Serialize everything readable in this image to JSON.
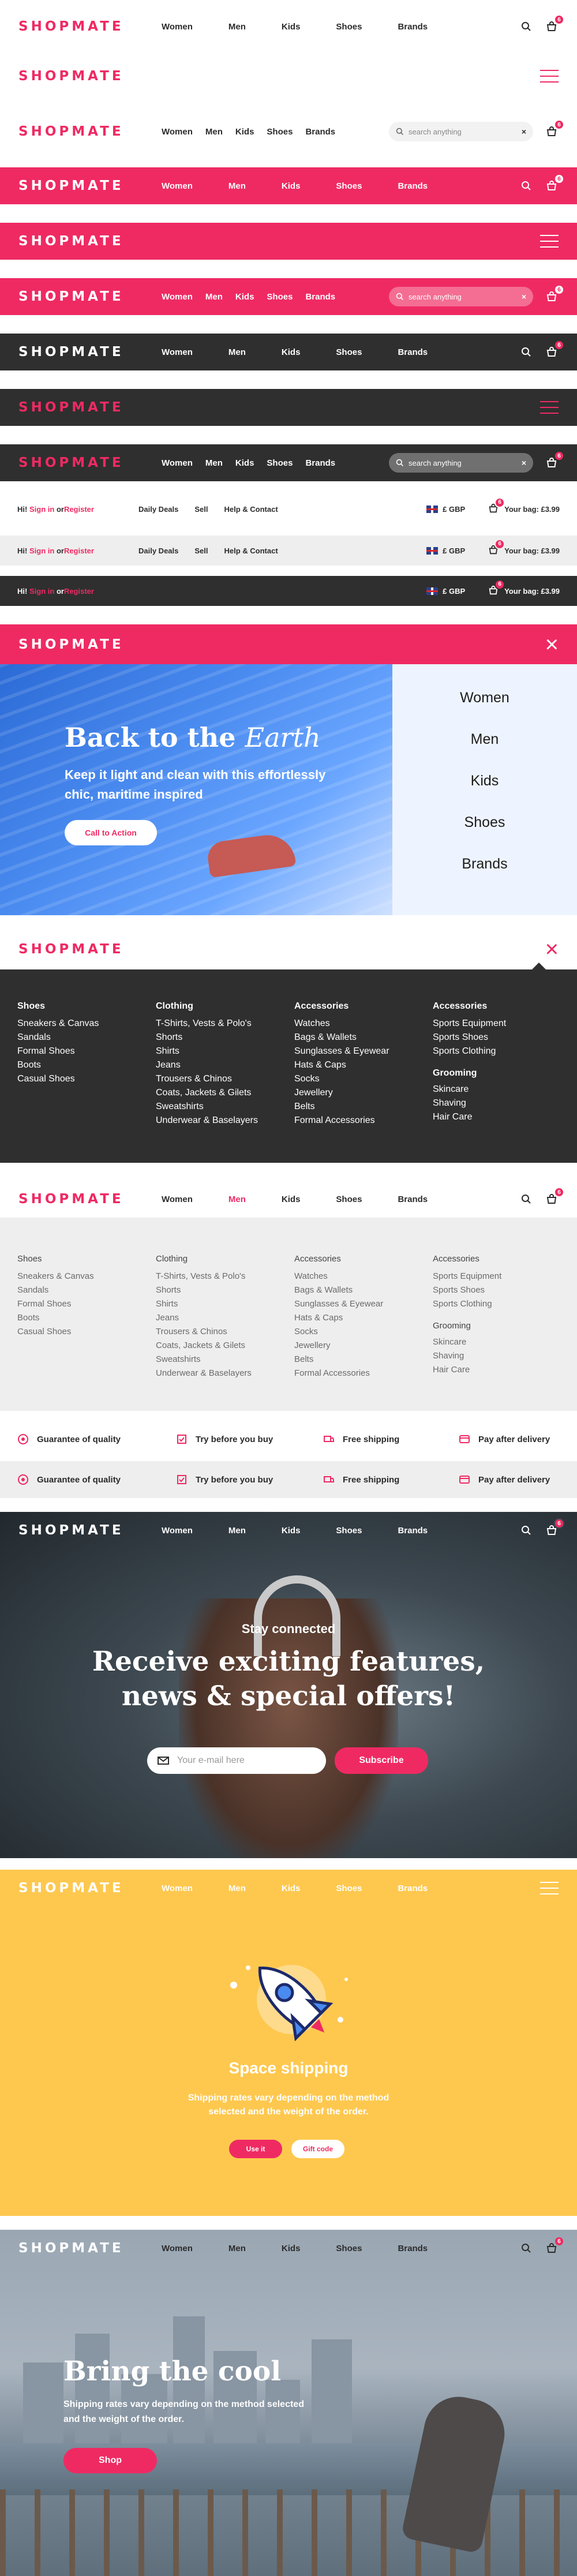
{
  "brand": {
    "logo": "SHOPMATE",
    "accent": "#ef2a63",
    "dark": "#2f2f2f",
    "yellow": "#fec84f"
  },
  "nav": [
    "Women",
    "Men",
    "Kids",
    "Shoes",
    "Brands"
  ],
  "search": {
    "placeholder": "search anything",
    "clear": "×"
  },
  "cart": {
    "count": "6"
  },
  "util_bar": {
    "greeting": "Hi!",
    "sign_in": "Sign in",
    "or": "or",
    "register": "Register",
    "links": [
      "Daily Deals",
      "Sell",
      "Help & Contact"
    ],
    "currency": "£ GBP",
    "bag_label": "Your bag: £3.99"
  },
  "hero_menu": {
    "title_plain": "Back to the ",
    "title_italic": "Earth",
    "subtitle": "Keep it light and clean with this effortlessly chic, maritime inspired",
    "cta": "Call to Action",
    "menu_items": [
      "Women",
      "Men",
      "Kids",
      "Shoes",
      "Brands"
    ],
    "close": "×"
  },
  "mega_menu": {
    "columns": [
      {
        "heading": "Shoes",
        "items": [
          "Sneakers & Canvas",
          "Sandals",
          "Formal Shoes",
          "Boots",
          "Casual Shoes"
        ]
      },
      {
        "heading": "Clothing",
        "items": [
          "T-Shirts, Vests & Polo's",
          "Shorts",
          "Shirts",
          "Jeans",
          "Trousers & Chinos",
          "Coats, Jackets & Gilets",
          "Sweatshirts",
          "Underwear & Baselayers"
        ]
      },
      {
        "heading": "Accessories",
        "items": [
          "Watches",
          "Bags & Wallets",
          "Sunglasses & Eyewear",
          "Hats & Caps",
          "Socks",
          "Jewellery",
          "Belts",
          "Formal Accessories"
        ]
      },
      {
        "heading": "Accessories",
        "items": [
          "Sports Equipment",
          "Sports Shoes",
          "Sports Clothing"
        ],
        "heading2": "Grooming",
        "items2": [
          "Skincare",
          "Shaving",
          "Hair Care"
        ]
      }
    ]
  },
  "features": [
    "Guarantee of quality",
    "Try before you buy",
    "Free shipping",
    "Pay after delivery"
  ],
  "newsletter": {
    "kicker": "Stay connected",
    "title_line1": "Receive exciting features,",
    "title_line2": "news & special offers!",
    "email_placeholder": "Your e-mail here",
    "button": "Subscribe"
  },
  "shipping": {
    "title": "Space shipping",
    "subtitle": "Shipping rates vary depending on the method selected and the weight of the order.",
    "use_button": "Use it",
    "gift_button": "Gift code"
  },
  "city_hero": {
    "title": "Bring the cool",
    "subtitle": "Shipping rates vary depending on the method selected and the weight of the order.",
    "button": "Shop"
  }
}
